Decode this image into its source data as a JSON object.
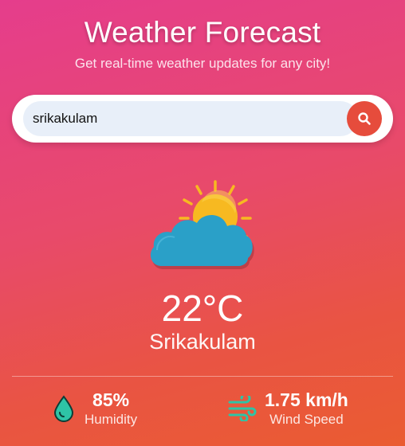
{
  "header": {
    "title": "Weather Forecast",
    "subtitle": "Get real-time weather updates for any city!"
  },
  "search": {
    "value": "srikakulam",
    "button_icon": "search-icon"
  },
  "weather": {
    "icon": "partly-cloudy-icon",
    "temperature": "22°C",
    "city": "Srikakulam"
  },
  "details": {
    "humidity": {
      "value": "85%",
      "label": "Humidity",
      "icon": "water-drop-icon"
    },
    "wind": {
      "value": "1.75 km/h",
      "label": "Wind Speed",
      "icon": "wind-icon"
    }
  },
  "colors": {
    "accent_button": "#e64c3c",
    "detail_icon": "#2ec4a6",
    "cloud": "#2aa0c8",
    "sun": "#f7b921"
  }
}
